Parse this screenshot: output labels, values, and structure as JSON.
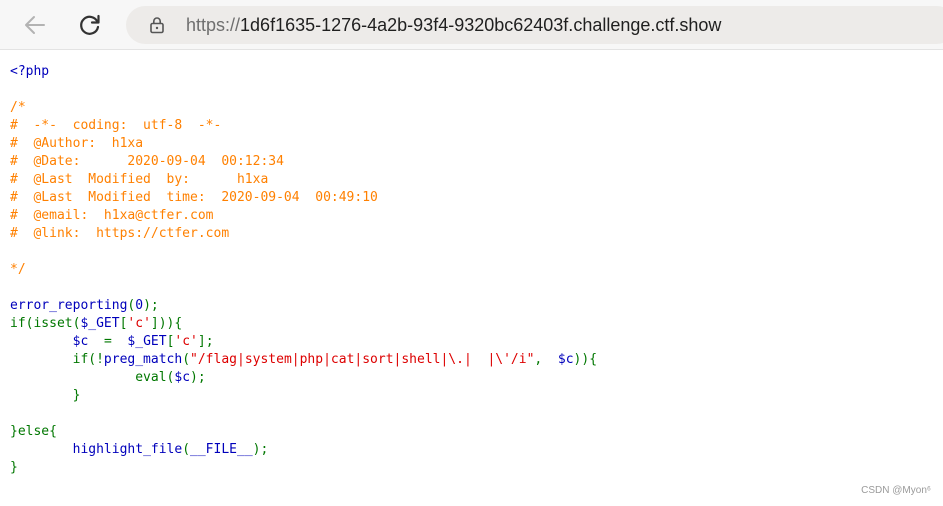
{
  "browser": {
    "url_scheme": "https://",
    "url_host": "1d6f1635-1276-4a2b-93f4-9320bc62403f.challenge.ctf.show"
  },
  "colors": {
    "default": "#0000bb",
    "comment": "#ff8000",
    "keyword": "#007700",
    "string": "#dd0000"
  },
  "code": {
    "lines": [
      [
        {
          "t": "<?php",
          "c": "default"
        }
      ],
      [],
      [
        {
          "t": "/*",
          "c": "comment"
        }
      ],
      [
        {
          "t": "#  -*-  coding:  utf-8  -*-",
          "c": "comment"
        }
      ],
      [
        {
          "t": "#  @Author:  h1xa",
          "c": "comment"
        }
      ],
      [
        {
          "t": "#  @Date:      2020-09-04  00:12:34",
          "c": "comment"
        }
      ],
      [
        {
          "t": "#  @Last  Modified  by:      h1xa",
          "c": "comment"
        }
      ],
      [
        {
          "t": "#  @Last  Modified  time:  2020-09-04  00:49:10",
          "c": "comment"
        }
      ],
      [
        {
          "t": "#  @email:  h1xa@ctfer.com",
          "c": "comment"
        }
      ],
      [
        {
          "t": "#  @link:  https://ctfer.com",
          "c": "comment"
        }
      ],
      [],
      [
        {
          "t": "*/",
          "c": "comment"
        }
      ],
      [],
      [
        {
          "t": "error_reporting",
          "c": "default"
        },
        {
          "t": "(",
          "c": "keyword"
        },
        {
          "t": "0",
          "c": "default"
        },
        {
          "t": ");",
          "c": "keyword"
        }
      ],
      [
        {
          "t": "if(isset(",
          "c": "keyword"
        },
        {
          "t": "$_GET",
          "c": "default"
        },
        {
          "t": "[",
          "c": "keyword"
        },
        {
          "t": "'c'",
          "c": "string"
        },
        {
          "t": "])){",
          "c": "keyword"
        }
      ],
      [
        {
          "t": "        ",
          "c": "keyword"
        },
        {
          "t": "$c  ",
          "c": "default"
        },
        {
          "t": "=  ",
          "c": "keyword"
        },
        {
          "t": "$_GET",
          "c": "default"
        },
        {
          "t": "[",
          "c": "keyword"
        },
        {
          "t": "'c'",
          "c": "string"
        },
        {
          "t": "];",
          "c": "keyword"
        }
      ],
      [
        {
          "t": "        if(!",
          "c": "keyword"
        },
        {
          "t": "preg_match",
          "c": "default"
        },
        {
          "t": "(",
          "c": "keyword"
        },
        {
          "t": "\"/flag|system|php|cat|sort|shell|\\.|  |\\'/i\"",
          "c": "string"
        },
        {
          "t": ",  ",
          "c": "keyword"
        },
        {
          "t": "$c",
          "c": "default"
        },
        {
          "t": ")){",
          "c": "keyword"
        }
      ],
      [
        {
          "t": "                eval(",
          "c": "keyword"
        },
        {
          "t": "$c",
          "c": "default"
        },
        {
          "t": ");",
          "c": "keyword"
        }
      ],
      [
        {
          "t": "        }",
          "c": "keyword"
        }
      ],
      [],
      [
        {
          "t": "}else{",
          "c": "keyword"
        }
      ],
      [
        {
          "t": "        ",
          "c": "keyword"
        },
        {
          "t": "highlight_file",
          "c": "default"
        },
        {
          "t": "(",
          "c": "keyword"
        },
        {
          "t": "__FILE__",
          "c": "default"
        },
        {
          "t": ");",
          "c": "keyword"
        }
      ],
      [
        {
          "t": "}",
          "c": "keyword"
        }
      ]
    ]
  },
  "watermark": "CSDN @Myon⁶"
}
